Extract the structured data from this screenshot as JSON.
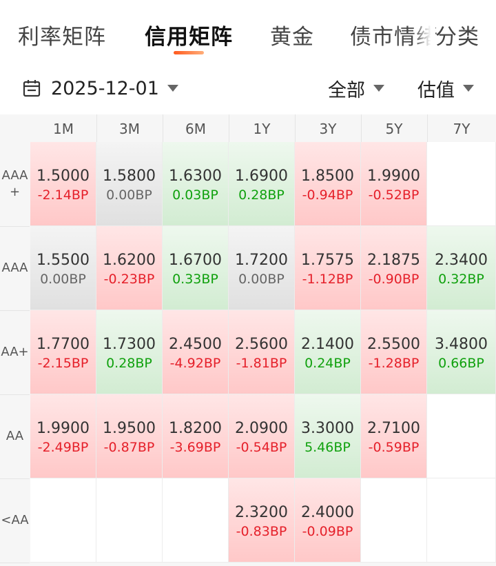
{
  "tabs": [
    {
      "label": "利率矩阵",
      "active": false
    },
    {
      "label": "信用矩阵",
      "active": true
    },
    {
      "label": "黄金",
      "active": false
    },
    {
      "label": "债市情绪",
      "active": false
    },
    {
      "label": "分类",
      "active": false
    }
  ],
  "filters": {
    "date": "2025-12-01",
    "scope": "全部",
    "metric": "估值"
  },
  "matrix": {
    "columns": [
      "1M",
      "3M",
      "6M",
      "1Y",
      "3Y",
      "5Y",
      "7Y"
    ],
    "rows": [
      {
        "label": "AAA+",
        "label_lines": [
          "AAA",
          "+"
        ],
        "cells": [
          {
            "value": "1.5000",
            "change": "-2.14BP",
            "trend": "up"
          },
          {
            "value": "1.5800",
            "change": "0.00BP",
            "trend": "flat"
          },
          {
            "value": "1.6300",
            "change": "0.03BP",
            "trend": "down"
          },
          {
            "value": "1.6900",
            "change": "0.28BP",
            "trend": "down"
          },
          {
            "value": "1.8500",
            "change": "-0.94BP",
            "trend": "up"
          },
          {
            "value": "1.9900",
            "change": "-0.52BP",
            "trend": "up"
          },
          {
            "value": "",
            "change": "",
            "trend": "empty"
          }
        ]
      },
      {
        "label": "AAA",
        "label_lines": [
          "AAA"
        ],
        "cells": [
          {
            "value": "1.5500",
            "change": "0.00BP",
            "trend": "flat"
          },
          {
            "value": "1.6200",
            "change": "-0.23BP",
            "trend": "up"
          },
          {
            "value": "1.6700",
            "change": "0.33BP",
            "trend": "down"
          },
          {
            "value": "1.7200",
            "change": "0.00BP",
            "trend": "flat"
          },
          {
            "value": "1.7575",
            "change": "-1.12BP",
            "trend": "up"
          },
          {
            "value": "2.1875",
            "change": "-0.90BP",
            "trend": "up"
          },
          {
            "value": "2.3400",
            "change": "0.32BP",
            "trend": "down"
          }
        ]
      },
      {
        "label": "AA+",
        "label_lines": [
          "AA+"
        ],
        "cells": [
          {
            "value": "1.7700",
            "change": "-2.15BP",
            "trend": "up"
          },
          {
            "value": "1.7300",
            "change": "0.28BP",
            "trend": "down"
          },
          {
            "value": "2.4500",
            "change": "-4.92BP",
            "trend": "up"
          },
          {
            "value": "2.5600",
            "change": "-1.81BP",
            "trend": "up"
          },
          {
            "value": "2.1400",
            "change": "0.24BP",
            "trend": "down"
          },
          {
            "value": "2.5500",
            "change": "-1.28BP",
            "trend": "up"
          },
          {
            "value": "3.4800",
            "change": "0.66BP",
            "trend": "down"
          }
        ]
      },
      {
        "label": "AA",
        "label_lines": [
          "AA"
        ],
        "cells": [
          {
            "value": "1.9900",
            "change": "-2.49BP",
            "trend": "up"
          },
          {
            "value": "1.9500",
            "change": "-0.87BP",
            "trend": "up"
          },
          {
            "value": "1.8200",
            "change": "-3.69BP",
            "trend": "up"
          },
          {
            "value": "2.0900",
            "change": "-0.54BP",
            "trend": "up"
          },
          {
            "value": "3.3000",
            "change": "5.46BP",
            "trend": "down"
          },
          {
            "value": "2.7100",
            "change": "-0.59BP",
            "trend": "up"
          },
          {
            "value": "",
            "change": "",
            "trend": "empty"
          }
        ]
      },
      {
        "label": "<AA",
        "label_lines": [
          "<AA"
        ],
        "cells": [
          {
            "value": "",
            "change": "",
            "trend": "empty"
          },
          {
            "value": "",
            "change": "",
            "trend": "empty"
          },
          {
            "value": "",
            "change": "",
            "trend": "empty"
          },
          {
            "value": "2.3200",
            "change": "-0.83BP",
            "trend": "up"
          },
          {
            "value": "2.4000",
            "change": "-0.09BP",
            "trend": "up"
          },
          {
            "value": "",
            "change": "",
            "trend": "empty"
          },
          {
            "value": "",
            "change": "",
            "trend": "empty"
          }
        ]
      }
    ]
  },
  "colors": {
    "negative_change": "#e5202a",
    "positive_change": "#10a10e",
    "accent": "#ff5a1e"
  },
  "icons": {
    "calendar": "calendar-icon",
    "dropdown": "caret-down-icon"
  }
}
